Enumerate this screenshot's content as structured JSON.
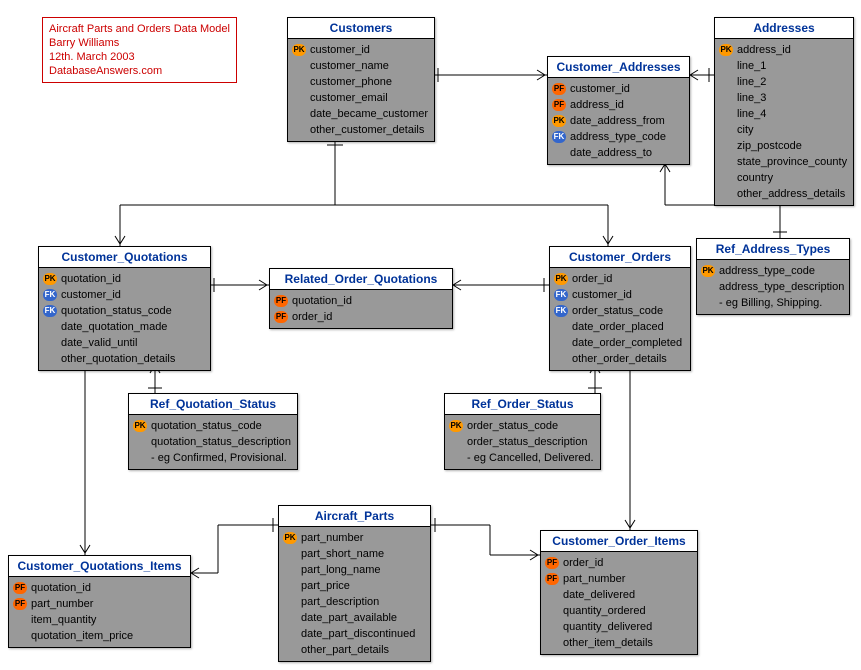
{
  "info": {
    "title": "Aircraft Parts and Orders Data Model",
    "author": "Barry Williams",
    "date": "12th. March 2003",
    "site": "DatabaseAnswers.com"
  },
  "entities": {
    "customers": {
      "title": "Customers",
      "attrs": [
        {
          "k": "pk",
          "n": "customer_id"
        },
        {
          "k": "",
          "n": "customer_name"
        },
        {
          "k": "",
          "n": "customer_phone"
        },
        {
          "k": "",
          "n": "customer_email"
        },
        {
          "k": "",
          "n": "date_became_customer"
        },
        {
          "k": "",
          "n": "other_customer_details"
        }
      ]
    },
    "addresses": {
      "title": "Addresses",
      "attrs": [
        {
          "k": "pk",
          "n": "address_id"
        },
        {
          "k": "",
          "n": "line_1"
        },
        {
          "k": "",
          "n": "line_2"
        },
        {
          "k": "",
          "n": "line_3"
        },
        {
          "k": "",
          "n": "line_4"
        },
        {
          "k": "",
          "n": "city"
        },
        {
          "k": "",
          "n": "zip_postcode"
        },
        {
          "k": "",
          "n": "state_province_county"
        },
        {
          "k": "",
          "n": "country"
        },
        {
          "k": "",
          "n": "other_address_details"
        }
      ]
    },
    "customer_addresses": {
      "title": "Customer_Addresses",
      "attrs": [
        {
          "k": "pf",
          "n": "customer_id"
        },
        {
          "k": "pf",
          "n": "address_id"
        },
        {
          "k": "pk",
          "n": "date_address_from"
        },
        {
          "k": "fk",
          "n": "address_type_code"
        },
        {
          "k": "",
          "n": "date_address_to"
        }
      ]
    },
    "ref_address_types": {
      "title": "Ref_Address_Types",
      "attrs": [
        {
          "k": "pk",
          "n": "address_type_code"
        },
        {
          "k": "",
          "n": "address_type_description"
        },
        {
          "k": "",
          "n": "- eg Billing, Shipping."
        }
      ]
    },
    "customer_quotations": {
      "title": "Customer_Quotations",
      "attrs": [
        {
          "k": "pk",
          "n": "quotation_id"
        },
        {
          "k": "fk",
          "n": "customer_id"
        },
        {
          "k": "fk",
          "n": "quotation_status_code"
        },
        {
          "k": "",
          "n": "date_quotation_made"
        },
        {
          "k": "",
          "n": "date_valid_until"
        },
        {
          "k": "",
          "n": "other_quotation_details"
        }
      ]
    },
    "related_order_quotations": {
      "title": "Related_Order_Quotations",
      "attrs": [
        {
          "k": "pf",
          "n": "quotation_id"
        },
        {
          "k": "pf",
          "n": "order_id"
        }
      ]
    },
    "customer_orders": {
      "title": "Customer_Orders",
      "attrs": [
        {
          "k": "pk",
          "n": "order_id"
        },
        {
          "k": "fk",
          "n": "customer_id"
        },
        {
          "k": "fk",
          "n": "order_status_code"
        },
        {
          "k": "",
          "n": "date_order_placed"
        },
        {
          "k": "",
          "n": "date_order_completed"
        },
        {
          "k": "",
          "n": "other_order_details"
        }
      ]
    },
    "ref_quotation_status": {
      "title": "Ref_Quotation_Status",
      "attrs": [
        {
          "k": "pk",
          "n": "quotation_status_code"
        },
        {
          "k": "",
          "n": "quotation_status_description"
        },
        {
          "k": "",
          "n": "- eg Confirmed, Provisional."
        }
      ]
    },
    "ref_order_status": {
      "title": "Ref_Order_Status",
      "attrs": [
        {
          "k": "pk",
          "n": "order_status_code"
        },
        {
          "k": "",
          "n": "order_status_description"
        },
        {
          "k": "",
          "n": "- eg Cancelled, Delivered."
        }
      ]
    },
    "aircraft_parts": {
      "title": "Aircraft_Parts",
      "attrs": [
        {
          "k": "pk",
          "n": "part_number"
        },
        {
          "k": "",
          "n": "part_short_name"
        },
        {
          "k": "",
          "n": "part_long_name"
        },
        {
          "k": "",
          "n": "part_price"
        },
        {
          "k": "",
          "n": "part_description"
        },
        {
          "k": "",
          "n": "date_part_available"
        },
        {
          "k": "",
          "n": "date_part_discontinued"
        },
        {
          "k": "",
          "n": "other_part_details"
        }
      ]
    },
    "customer_quotations_items": {
      "title": "Customer_Quotations_Items",
      "attrs": [
        {
          "k": "pf",
          "n": "quotation_id"
        },
        {
          "k": "pf",
          "n": "part_number"
        },
        {
          "k": "",
          "n": "item_quantity"
        },
        {
          "k": "",
          "n": "quotation_item_price"
        }
      ]
    },
    "customer_order_items": {
      "title": "Customer_Order_Items",
      "attrs": [
        {
          "k": "pf",
          "n": "order_id"
        },
        {
          "k": "pf",
          "n": "part_number"
        },
        {
          "k": "",
          "n": "date_delivered"
        },
        {
          "k": "",
          "n": "quantity_ordered"
        },
        {
          "k": "",
          "n": "quantity_delivered"
        },
        {
          "k": "",
          "n": "other_item_details"
        }
      ]
    }
  }
}
